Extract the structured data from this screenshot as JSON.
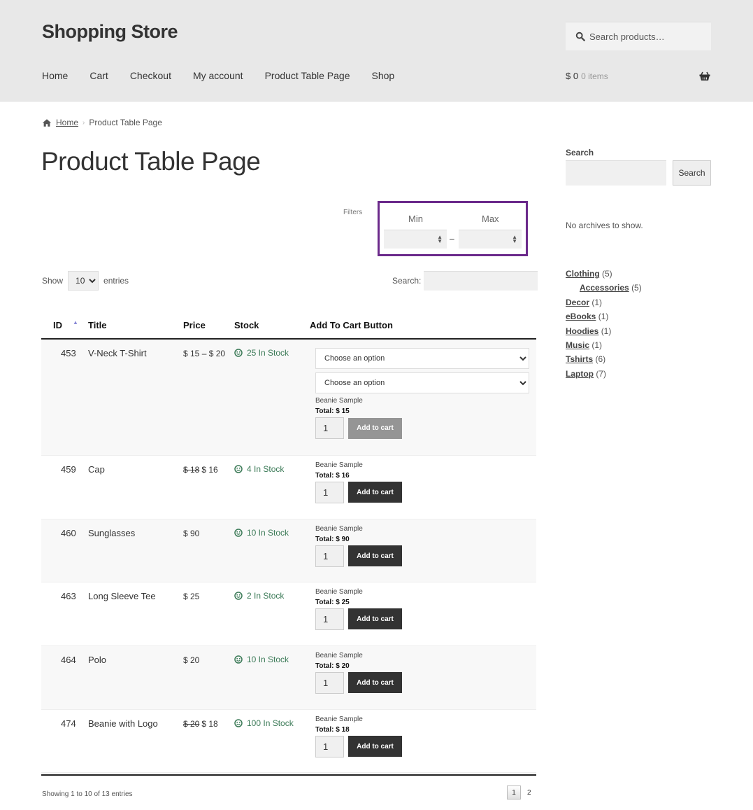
{
  "header": {
    "site_title": "Shopping Store",
    "search_placeholder": "Search products…",
    "nav": [
      "Home",
      "Cart",
      "Checkout",
      "My account",
      "Product Table Page",
      "Shop"
    ],
    "cart_total": "$ 0",
    "cart_count": "0 items"
  },
  "breadcrumb": {
    "home": "Home",
    "current": "Product Table Page"
  },
  "page_title": "Product Table Page",
  "filters": {
    "label": "Filters",
    "min_label": "Min",
    "max_label": "Max",
    "dash": "–",
    "accent_color": "#6b2a8b"
  },
  "table_controls": {
    "show_label": "Show",
    "entries_label": "entries",
    "page_size": "10",
    "search_label": "Search:"
  },
  "table": {
    "headers": [
      "ID",
      "Title",
      "Price",
      "Stock",
      "Add To Cart Button"
    ],
    "rows": [
      {
        "id": "453",
        "title": "V-Neck T-Shirt",
        "price_old": "",
        "price": "$ 15 – $ 20",
        "stock": "25 In Stock",
        "variations": [
          "Choose an option",
          "Choose an option"
        ],
        "sample": "Beanie Sample",
        "total": "Total: $ 15",
        "qty": "1",
        "button": "Add to cart",
        "button_disabled": true
      },
      {
        "id": "459",
        "title": "Cap",
        "price_old": "$ 18",
        "price": "$ 16",
        "stock": "4 In Stock",
        "variations": [],
        "sample": "Beanie Sample",
        "total": "Total: $ 16",
        "qty": "1",
        "button": "Add to cart",
        "button_disabled": false
      },
      {
        "id": "460",
        "title": "Sunglasses",
        "price_old": "",
        "price": "$ 90",
        "stock": "10 In Stock",
        "variations": [],
        "sample": "Beanie Sample",
        "total": "Total: $ 90",
        "qty": "1",
        "button": "Add to cart",
        "button_disabled": false
      },
      {
        "id": "463",
        "title": "Long Sleeve Tee",
        "price_old": "",
        "price": "$ 25",
        "stock": "2 In Stock",
        "variations": [],
        "sample": "Beanie Sample",
        "total": "Total: $ 25",
        "qty": "1",
        "button": "Add to cart",
        "button_disabled": false
      },
      {
        "id": "464",
        "title": "Polo",
        "price_old": "",
        "price": "$ 20",
        "stock": "10 In Stock",
        "variations": [],
        "sample": "Beanie Sample",
        "total": "Total: $ 20",
        "qty": "1",
        "button": "Add to cart",
        "button_disabled": false
      },
      {
        "id": "474",
        "title": "Beanie with Logo",
        "price_old": "$ 20",
        "price": "$ 18",
        "stock": "100 In Stock",
        "variations": [],
        "sample": "Beanie Sample",
        "total": "Total: $ 18",
        "qty": "1",
        "button": "Add to cart",
        "button_disabled": false
      }
    ],
    "info": "Showing 1 to 10 of 13 entries",
    "pages": [
      "1",
      "2"
    ],
    "current_page": "1"
  },
  "sidebar": {
    "search_title": "Search",
    "search_button": "Search",
    "no_archives": "No archives to show.",
    "categories": [
      {
        "name": "Clothing",
        "count": "(5)",
        "child": false
      },
      {
        "name": "Accessories",
        "count": "(5)",
        "child": true
      },
      {
        "name": "Decor",
        "count": "(1)",
        "child": false
      },
      {
        "name": "eBooks",
        "count": "(1)",
        "child": false
      },
      {
        "name": "Hoodies",
        "count": "(1)",
        "child": false
      },
      {
        "name": "Music",
        "count": "(1)",
        "child": false
      },
      {
        "name": "Tshirts",
        "count": "(6)",
        "child": false
      },
      {
        "name": "Laptop",
        "count": "(7)",
        "child": false
      }
    ]
  }
}
